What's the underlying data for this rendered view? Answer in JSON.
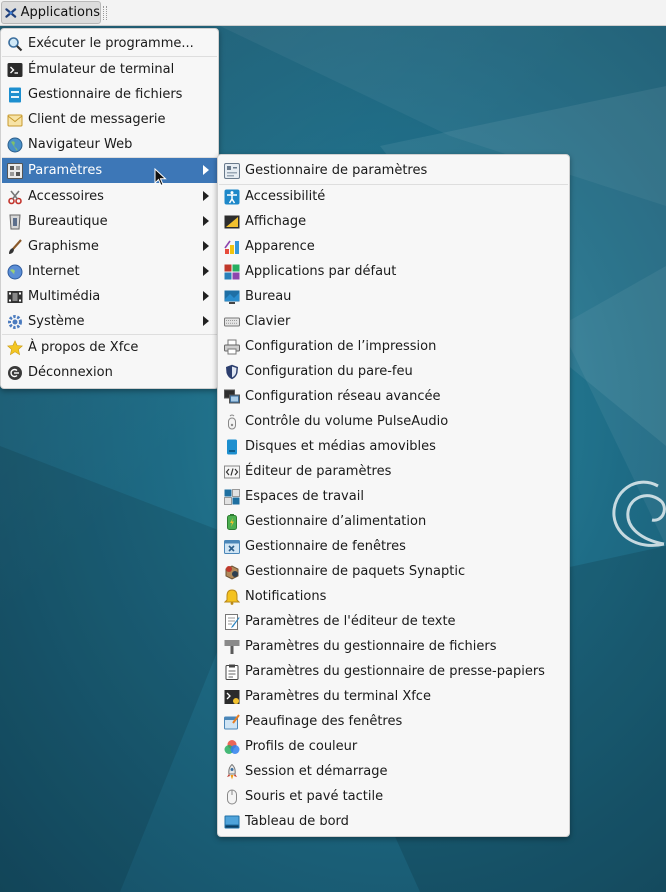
{
  "panel": {
    "applications_label": "Applications"
  },
  "main_menu": [
    {
      "label": "Exécuter le programme...",
      "icon": "search-run-icon"
    },
    {
      "label": "Émulateur de terminal",
      "icon": "terminal-icon"
    },
    {
      "label": "Gestionnaire de fichiers",
      "icon": "file-manager-icon"
    },
    {
      "label": "Client de messagerie",
      "icon": "mail-icon"
    },
    {
      "label": "Navigateur Web",
      "icon": "web-browser-icon"
    },
    {
      "label": "Paramètres",
      "icon": "settings-icon",
      "submenu": true,
      "active": true
    },
    {
      "label": "Accessoires",
      "icon": "accessories-icon",
      "submenu": true
    },
    {
      "label": "Bureautique",
      "icon": "office-icon",
      "submenu": true
    },
    {
      "label": "Graphisme",
      "icon": "graphics-icon",
      "submenu": true
    },
    {
      "label": "Internet",
      "icon": "internet-icon",
      "submenu": true
    },
    {
      "label": "Multimédia",
      "icon": "multimedia-icon",
      "submenu": true
    },
    {
      "label": "Système",
      "icon": "system-icon",
      "submenu": true
    },
    {
      "label": "À propos de Xfce",
      "icon": "star-icon"
    },
    {
      "label": "Déconnexion",
      "icon": "logout-icon"
    }
  ],
  "settings_submenu": [
    {
      "label": "Gestionnaire de paramètres",
      "icon": "settings-manager-icon"
    },
    {
      "label": "Accessibilité",
      "icon": "accessibility-icon"
    },
    {
      "label": "Affichage",
      "icon": "display-icon"
    },
    {
      "label": "Apparence",
      "icon": "appearance-icon"
    },
    {
      "label": "Applications par défaut",
      "icon": "default-apps-icon"
    },
    {
      "label": "Bureau",
      "icon": "desktop-icon"
    },
    {
      "label": "Clavier",
      "icon": "keyboard-icon"
    },
    {
      "label": "Configuration de l’impression",
      "icon": "printer-icon"
    },
    {
      "label": "Configuration du pare-feu",
      "icon": "firewall-icon"
    },
    {
      "label": "Configuration réseau avancée",
      "icon": "network-icon"
    },
    {
      "label": "Contrôle du volume PulseAudio",
      "icon": "volume-icon"
    },
    {
      "label": "Disques et médias amovibles",
      "icon": "removable-media-icon"
    },
    {
      "label": "Éditeur de paramètres",
      "icon": "settings-editor-icon"
    },
    {
      "label": "Espaces de travail",
      "icon": "workspaces-icon"
    },
    {
      "label": "Gestionnaire d’alimentation",
      "icon": "power-manager-icon"
    },
    {
      "label": "Gestionnaire de fenêtres",
      "icon": "window-manager-icon"
    },
    {
      "label": "Gestionnaire de paquets Synaptic",
      "icon": "package-manager-icon"
    },
    {
      "label": "Notifications",
      "icon": "bell-icon"
    },
    {
      "label": "Paramètres de l'éditeur de texte",
      "icon": "text-editor-icon"
    },
    {
      "label": "Paramètres du gestionnaire de fichiers",
      "icon": "file-manager-settings-icon"
    },
    {
      "label": "Paramètres du gestionnaire de presse-papiers",
      "icon": "clipboard-icon"
    },
    {
      "label": "Paramètres du terminal Xfce",
      "icon": "terminal-settings-icon"
    },
    {
      "label": "Peaufinage des fenêtres",
      "icon": "window-tweaks-icon"
    },
    {
      "label": "Profils de couleur",
      "icon": "color-profiles-icon"
    },
    {
      "label": "Session et démarrage",
      "icon": "session-icon"
    },
    {
      "label": "Souris et pavé tactile",
      "icon": "mouse-icon"
    },
    {
      "label": "Tableau de bord",
      "icon": "panel-icon"
    }
  ],
  "colors": {
    "highlight": "#3d77b7",
    "menu_bg": "#f7f7f7",
    "desktop": "#1e6c86"
  }
}
